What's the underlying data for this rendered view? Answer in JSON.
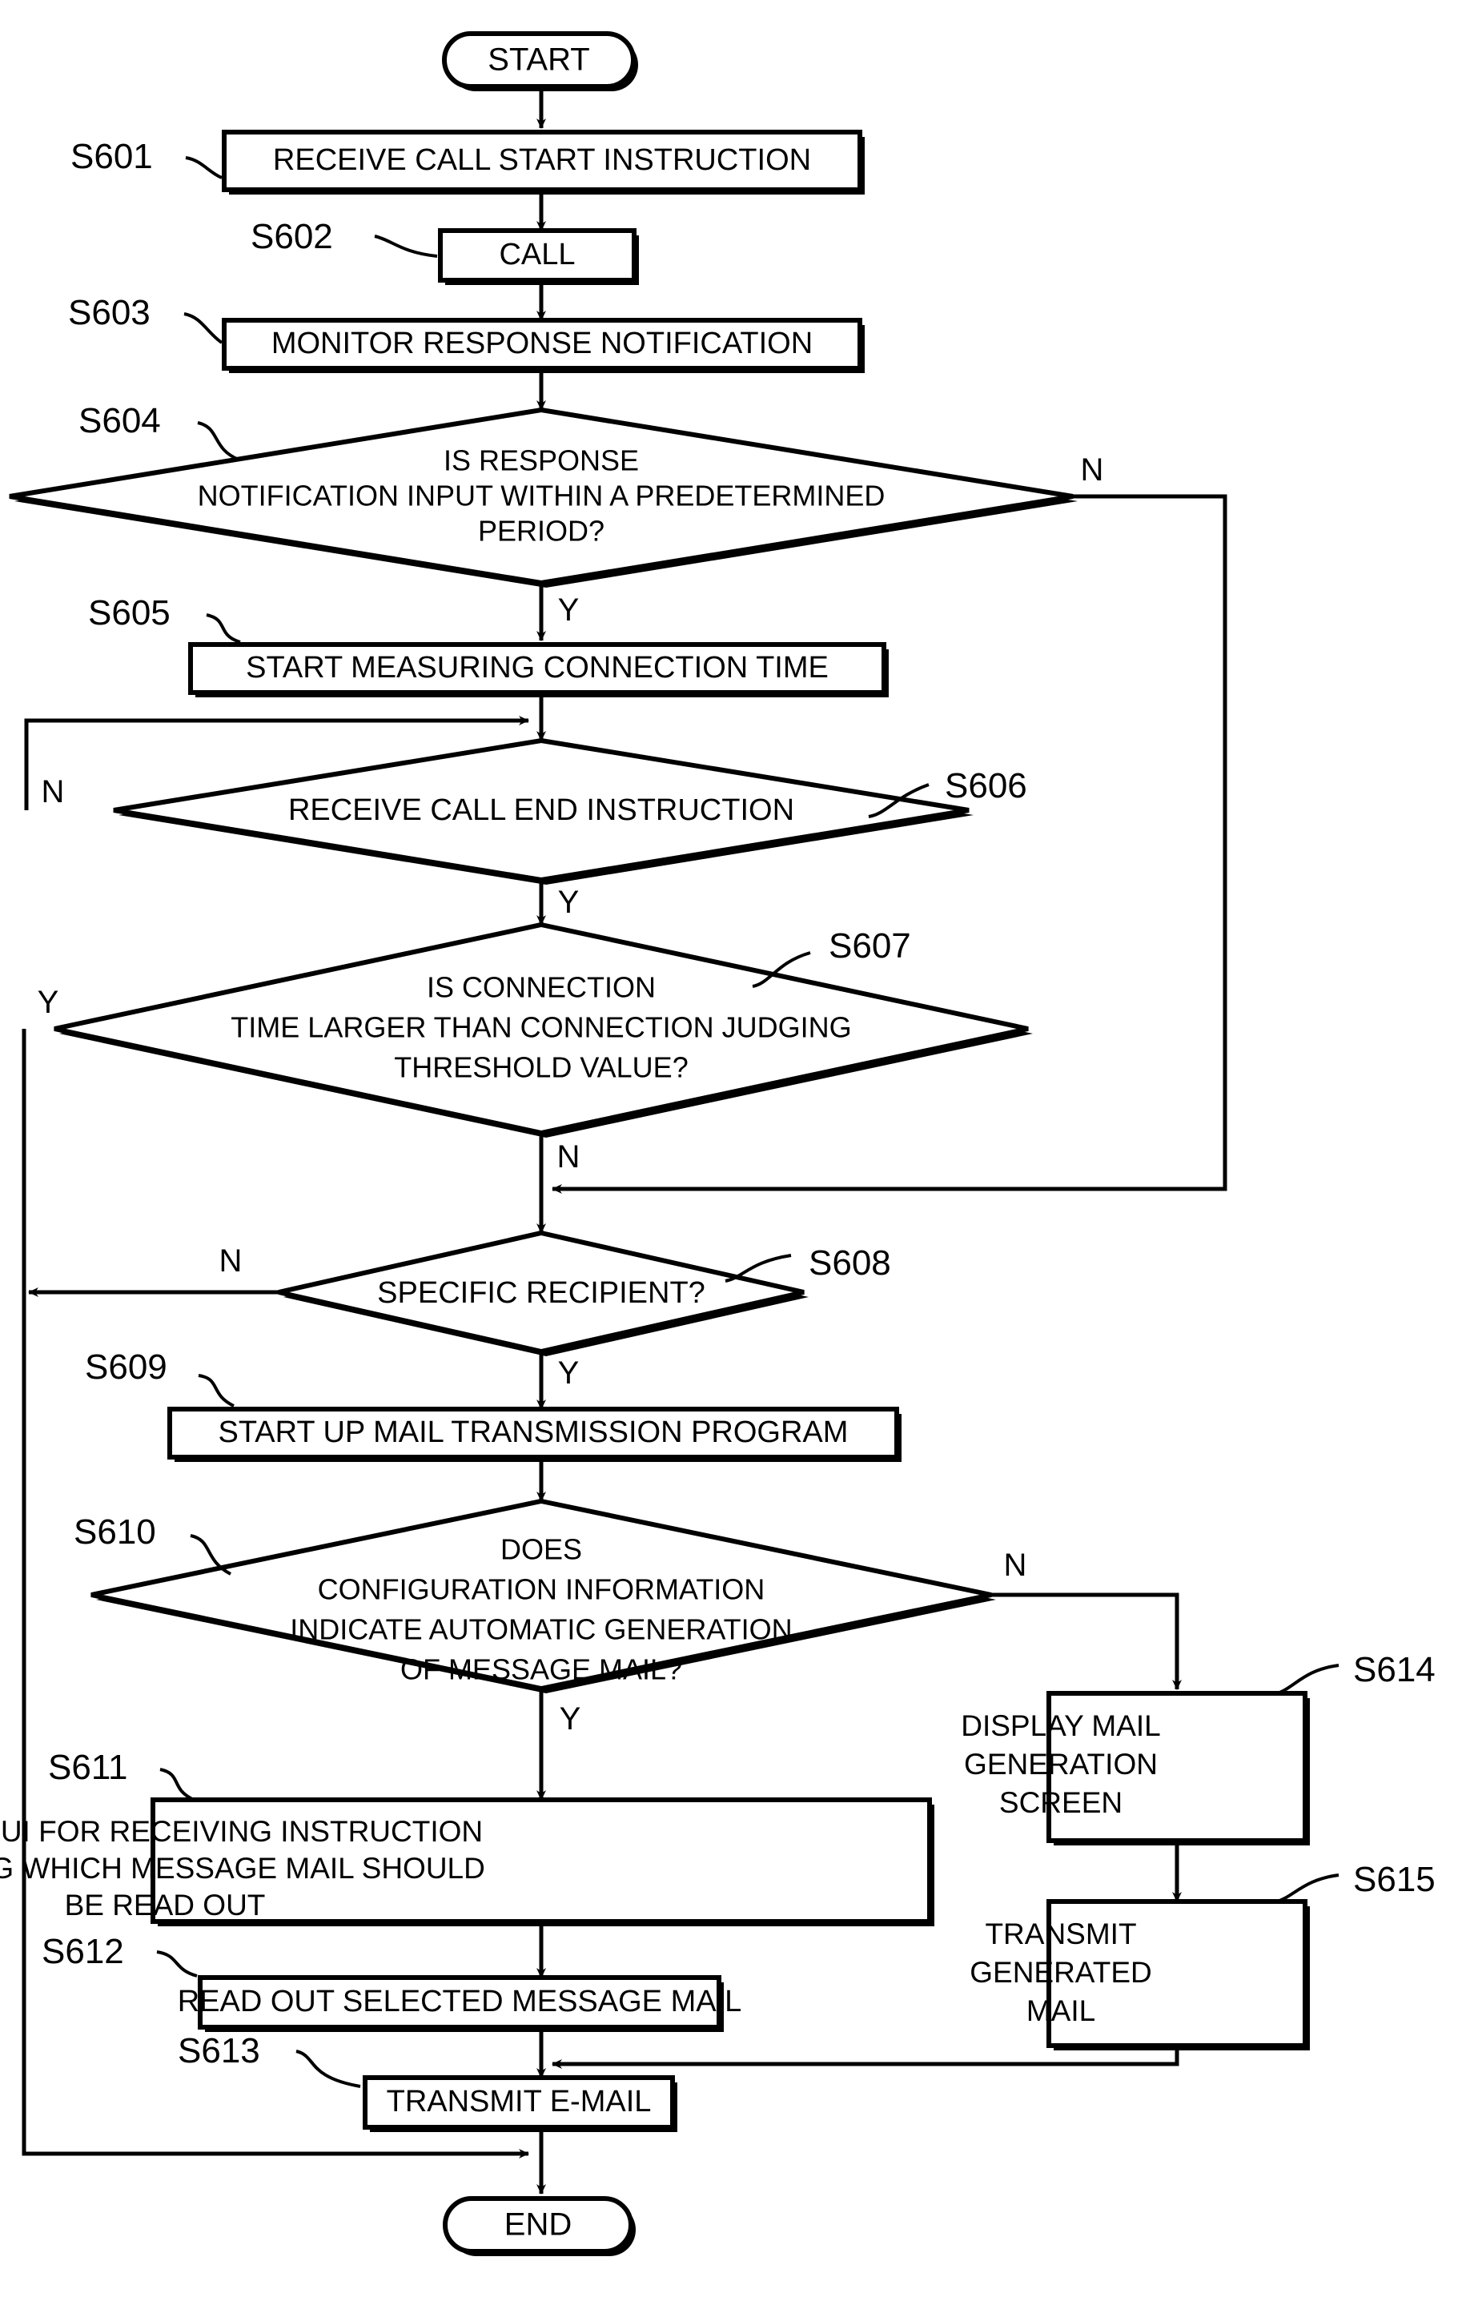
{
  "figure": {
    "type": "flowchart",
    "orientation": "vertical",
    "line_color": "#000000",
    "fill_color": "#ffffff",
    "shadow_color": "#000000"
  },
  "terminals": {
    "start": "START",
    "end": "END"
  },
  "steps": [
    {
      "id": "S601",
      "tag": "S601",
      "shape": "process",
      "text": [
        "RECEIVE CALL START INSTRUCTION"
      ]
    },
    {
      "id": "S602",
      "tag": "S602",
      "shape": "process",
      "text": [
        "CALL"
      ]
    },
    {
      "id": "S603",
      "tag": "S603",
      "shape": "process",
      "text": [
        "MONITOR RESPONSE NOTIFICATION"
      ]
    },
    {
      "id": "S604",
      "tag": "S604",
      "shape": "decision",
      "text": [
        "IS RESPONSE",
        "NOTIFICATION INPUT WITHIN A PREDETERMINED",
        "PERIOD?"
      ]
    },
    {
      "id": "S605",
      "tag": "S605",
      "shape": "process",
      "text": [
        "START MEASURING CONNECTION TIME"
      ]
    },
    {
      "id": "S606",
      "tag": "S606",
      "shape": "decision",
      "text": [
        "RECEIVE CALL END INSTRUCTION"
      ]
    },
    {
      "id": "S607",
      "tag": "S607",
      "shape": "decision",
      "text": [
        "IS CONNECTION",
        "TIME LARGER THAN CONNECTION JUDGING",
        "THRESHOLD VALUE?"
      ]
    },
    {
      "id": "S608",
      "tag": "S608",
      "shape": "decision",
      "text": [
        "SPECIFIC RECIPIENT?"
      ]
    },
    {
      "id": "S609",
      "tag": "S609",
      "shape": "process",
      "text": [
        "START UP MAIL TRANSMISSION PROGRAM"
      ]
    },
    {
      "id": "S610",
      "tag": "S610",
      "shape": "decision",
      "text": [
        "DOES",
        "CONFIGURATION INFORMATION",
        "INDICATE AUTOMATIC GENERATION",
        "OF MESSAGE MAIL?"
      ]
    },
    {
      "id": "S611",
      "tag": "S611",
      "shape": "process",
      "text": [
        "DISPLAY GUI FOR RECEIVING INSTRUCTION",
        "INDICATING WHICH MESSAGE MAIL SHOULD",
        "BE READ OUT"
      ]
    },
    {
      "id": "S612",
      "tag": "S612",
      "shape": "process",
      "text": [
        "READ OUT SELECTED MESSAGE MAIL"
      ]
    },
    {
      "id": "S613",
      "tag": "S613",
      "shape": "process",
      "text": [
        "TRANSMIT E-MAIL"
      ]
    },
    {
      "id": "S614",
      "tag": "S614",
      "shape": "process",
      "text": [
        "DISPLAY MAIL",
        "GENERATION",
        "SCREEN"
      ]
    },
    {
      "id": "S615",
      "tag": "S615",
      "shape": "process",
      "text": [
        "TRANSMIT",
        "GENERATED",
        "MAIL"
      ]
    }
  ],
  "branch_labels": {
    "s604_no": "N",
    "s604_yes": "Y",
    "s606_no": "N",
    "s606_yes": "Y",
    "s607_yes": "Y",
    "s607_no": "N",
    "s608_no": "N",
    "s608_yes": "Y",
    "s610_no": "N",
    "s610_yes": "Y"
  },
  "edges": [
    {
      "from": "START",
      "to": "S601",
      "label": ""
    },
    {
      "from": "S601",
      "to": "S602",
      "label": ""
    },
    {
      "from": "S602",
      "to": "S603",
      "label": ""
    },
    {
      "from": "S603",
      "to": "S604",
      "label": ""
    },
    {
      "from": "S604",
      "to": "S605",
      "label": "Y"
    },
    {
      "from": "S604",
      "to": "S608",
      "label": "N"
    },
    {
      "from": "S605",
      "to": "S606",
      "label": ""
    },
    {
      "from": "S606",
      "to": "S606",
      "label": "N"
    },
    {
      "from": "S606",
      "to": "S607",
      "label": "Y"
    },
    {
      "from": "S607",
      "to": "END",
      "label": "Y"
    },
    {
      "from": "S607",
      "to": "S608",
      "label": "N"
    },
    {
      "from": "S608",
      "to": "END",
      "label": "N"
    },
    {
      "from": "S608",
      "to": "S609",
      "label": "Y"
    },
    {
      "from": "S609",
      "to": "S610",
      "label": ""
    },
    {
      "from": "S610",
      "to": "S611",
      "label": "Y"
    },
    {
      "from": "S610",
      "to": "S614",
      "label": "N"
    },
    {
      "from": "S611",
      "to": "S612",
      "label": ""
    },
    {
      "from": "S612",
      "to": "S613",
      "label": ""
    },
    {
      "from": "S613",
      "to": "END",
      "label": ""
    },
    {
      "from": "S614",
      "to": "S615",
      "label": ""
    },
    {
      "from": "S615",
      "to": "S613",
      "label": ""
    }
  ]
}
